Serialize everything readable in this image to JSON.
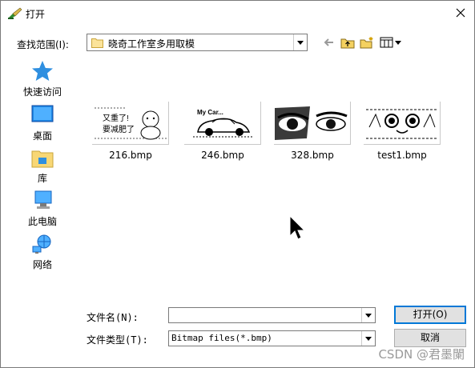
{
  "window": {
    "title": "打开"
  },
  "toolbar": {
    "lookin_label": "查找范围(I):",
    "lookin_value": "晓奇工作室多用取模",
    "icons": [
      "back-arrow-icon",
      "up-folder-icon",
      "new-folder-icon",
      "view-menu-icon"
    ]
  },
  "places": [
    {
      "label": "快速访问",
      "icon": "star-icon"
    },
    {
      "label": "桌面",
      "icon": "desktop-icon"
    },
    {
      "label": "库",
      "icon": "library-folder-icon"
    },
    {
      "label": "此电脑",
      "icon": "computer-icon"
    },
    {
      "label": "网络",
      "icon": "network-icon"
    }
  ],
  "files": [
    {
      "name": "216.bmp",
      "thumb_text_1": "又重了!",
      "thumb_text_2": "要减肥了"
    },
    {
      "name": "246.bmp",
      "thumb_text_1": "My Car..."
    },
    {
      "name": "328.bmp"
    },
    {
      "name": "test1.bmp"
    }
  ],
  "form": {
    "filename_label": "文件名(N):",
    "filename_value": "",
    "filetype_label": "文件类型(T):",
    "filetype_value": "Bitmap files(*.bmp)",
    "open_button": "打开(O)",
    "cancel_button": "取消"
  },
  "watermark": "CSDN @君墨闌",
  "colors": {
    "accent": "#0078d7",
    "folder": "#f8d775"
  }
}
